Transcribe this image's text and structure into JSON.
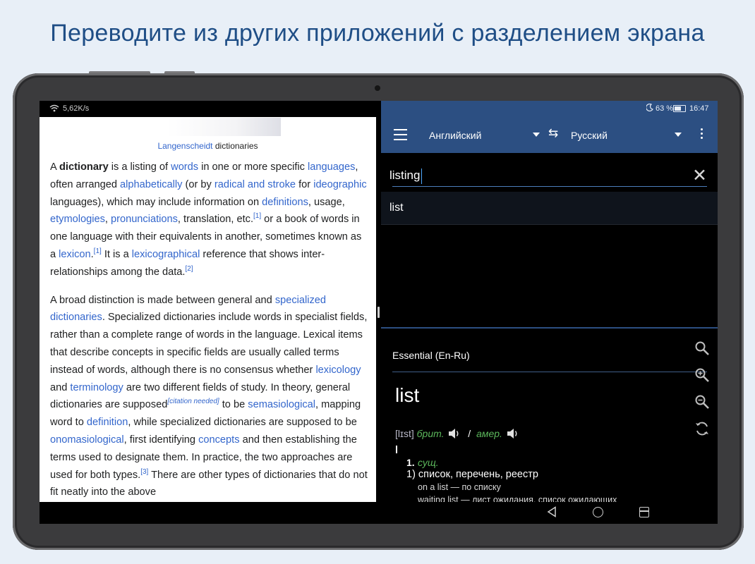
{
  "headline": "Переводите из других приложений с разделением экрана",
  "left_pane": {
    "status_speed": "5,62K/s",
    "caption_link": "Langenscheidt",
    "caption_text": " dictionaries",
    "p1": {
      "t1": "A ",
      "b1": "dictionary",
      "t2": " is a listing of ",
      "l1": "words",
      "t3": " in one or more specific ",
      "l2": "languages",
      "t4": ", often arranged ",
      "l3": "alphabetically",
      "t5": " (or by ",
      "l4": "radical and stroke",
      "t6": " for ",
      "l5": "ideographic",
      "t7": " languages), which may include information on ",
      "l6": "definitions",
      "t8": ", usage, ",
      "l7": "etymologies",
      "t9": ", ",
      "l8": "pronunciations",
      "t10": ", translation, etc.",
      "s1": "[1]",
      "t11": " or a book of words in one language with their equivalents in another, sometimes known as a ",
      "l9": "lexicon",
      "t12": ".",
      "s2": "[1]",
      "t13": " It is a ",
      "l10": "lexicographical",
      "t14": " reference that shows inter-relationships among the data.",
      "s3": "[2]"
    },
    "p2": {
      "t1": "A broad distinction is made between general and ",
      "l1": "specialized dictionaries",
      "t2": ". Specialized dictionaries include words in specialist fields, rather than a complete range of words in the language. Lexical items that describe concepts in specific fields are usually called terms instead of words, although there is no consensus whether ",
      "l2": "lexicology",
      "t3": " and ",
      "l3": "terminology",
      "t4": " are two different fields of study. In theory, general dictionaries are supposed",
      "s1": "[citation needed]",
      "t5": " to be ",
      "l4": "semasiological",
      "t6": ", mapping word to ",
      "l5": "definition",
      "t7": ", while specialized dictionaries are supposed to be ",
      "l6": "onomasiological",
      "t8": ", first identifying ",
      "l7": "concepts",
      "t9": " and then establishing the terms used to designate them. In practice, the two approaches are used for both types.",
      "s2": "[3]",
      "t10": " There are other types of dictionaries that do not fit neatly into the above"
    }
  },
  "right_pane": {
    "status_battery": "63 %",
    "status_time": "16:47",
    "source_lang": "Английский",
    "target_lang": "Русский",
    "search_value": "listing",
    "suggestion": "list",
    "dictionary_name": "Essential (En-Ru)",
    "headword": "list",
    "transcription": "[lɪst]",
    "label_brit": "брит.",
    "label_amer": "амер.",
    "separator": "/",
    "sense_number": "1.",
    "part_of_speech": "сущ.",
    "sense_1": "1) список, перечень, реестр",
    "example_1": "on a list — по списку",
    "example_2": "waiting list — лист ожидания, список ожидающих"
  },
  "colors": {
    "brand": "#2c4f82",
    "link": "#3366cc",
    "headline": "#1f4e86",
    "label_green": "#5cb85c"
  },
  "icons": [
    "wifi-icon",
    "menu-icon",
    "swap-icon",
    "more-icon",
    "close-icon",
    "search-icon",
    "zoom-in-icon",
    "zoom-out-icon",
    "sync-icon",
    "speaker-icon",
    "back-icon",
    "home-icon",
    "recents-icon",
    "moon-icon",
    "battery-icon"
  ]
}
